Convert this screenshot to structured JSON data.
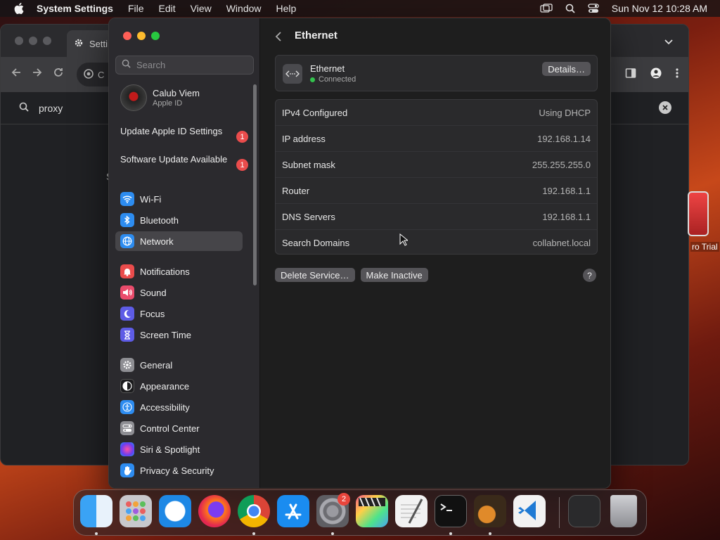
{
  "menubar": {
    "app_name": "System Settings",
    "menus": [
      "File",
      "Edit",
      "View",
      "Window",
      "Help"
    ],
    "datetime": "Sun Nov 12  10:28 AM",
    "icons": [
      "screen-mirroring-icon",
      "spotlight-icon",
      "control-center-icon"
    ]
  },
  "browser": {
    "tab_label": "Setti",
    "url_text": "C",
    "search_query": "proxy",
    "stub_text": "S"
  },
  "desktop": {
    "icon_label": "ro Trial"
  },
  "sidebar": {
    "search_placeholder": "Search",
    "profile": {
      "name": "Calub Viem",
      "subtitle": "Apple ID"
    },
    "notices": [
      {
        "label": "Update Apple ID Settings",
        "badge": "1"
      },
      {
        "label": "Software Update Available",
        "badge": "1"
      }
    ],
    "items": [
      {
        "label": "Wi-Fi",
        "icon": "wifi-icon",
        "color": "#2d8cf0"
      },
      {
        "label": "Bluetooth",
        "icon": "bluetooth-icon",
        "color": "#2d8cf0"
      },
      {
        "label": "Network",
        "icon": "network-globe-icon",
        "color": "#2d8cf0",
        "selected": true
      },
      {
        "label": "Notifications",
        "icon": "bell-icon",
        "color": "#ea4c4c"
      },
      {
        "label": "Sound",
        "icon": "speaker-icon",
        "color": "#ea4c6c"
      },
      {
        "label": "Focus",
        "icon": "moon-icon",
        "color": "#5e5ce6"
      },
      {
        "label": "Screen Time",
        "icon": "hourglass-icon",
        "color": "#5e5ce6"
      },
      {
        "label": "General",
        "icon": "gear-icon",
        "color": "#8e8e93"
      },
      {
        "label": "Appearance",
        "icon": "appearance-icon",
        "color": "#1c1c1e"
      },
      {
        "label": "Accessibility",
        "icon": "accessibility-icon",
        "color": "#2d8cf0"
      },
      {
        "label": "Control Center",
        "icon": "toggles-icon",
        "color": "#8e8e93"
      },
      {
        "label": "Siri & Spotlight",
        "icon": "siri-icon",
        "color": "#b04cd8"
      },
      {
        "label": "Privacy & Security",
        "icon": "hand-icon",
        "color": "#2d8cf0"
      }
    ]
  },
  "main": {
    "title": "Ethernet",
    "service": {
      "name": "Ethernet",
      "status": "Connected",
      "status_color": "#33c24d",
      "details_button": "Details…"
    },
    "rows": [
      {
        "key": "IPv4 Configured",
        "value": "Using DHCP"
      },
      {
        "key": "IP address",
        "value": "192.168.1.14"
      },
      {
        "key": "Subnet mask",
        "value": "255.255.255.0"
      },
      {
        "key": "Router",
        "value": "192.168.1.1"
      },
      {
        "key": "DNS Servers",
        "value": "192.168.1.1"
      },
      {
        "key": "Search Domains",
        "value": "collabnet.local"
      }
    ],
    "actions": {
      "delete": "Delete Service…",
      "inactive": "Make Inactive",
      "help": "?"
    }
  },
  "dock": {
    "apps": [
      {
        "name": "finder",
        "running": true
      },
      {
        "name": "launchpad",
        "running": false
      },
      {
        "name": "safari",
        "running": false
      },
      {
        "name": "firefox",
        "running": false
      },
      {
        "name": "chrome",
        "running": true
      },
      {
        "name": "app-store",
        "running": false
      },
      {
        "name": "system-settings",
        "running": true,
        "badge": "2"
      },
      {
        "name": "final-cut-pro",
        "running": false
      },
      {
        "name": "textedit",
        "running": false
      },
      {
        "name": "terminal",
        "running": true
      },
      {
        "name": "garageband",
        "running": true
      },
      {
        "name": "vscode",
        "running": false
      },
      {
        "name": "minimized-window",
        "running": false
      },
      {
        "name": "trash",
        "running": false
      }
    ]
  }
}
